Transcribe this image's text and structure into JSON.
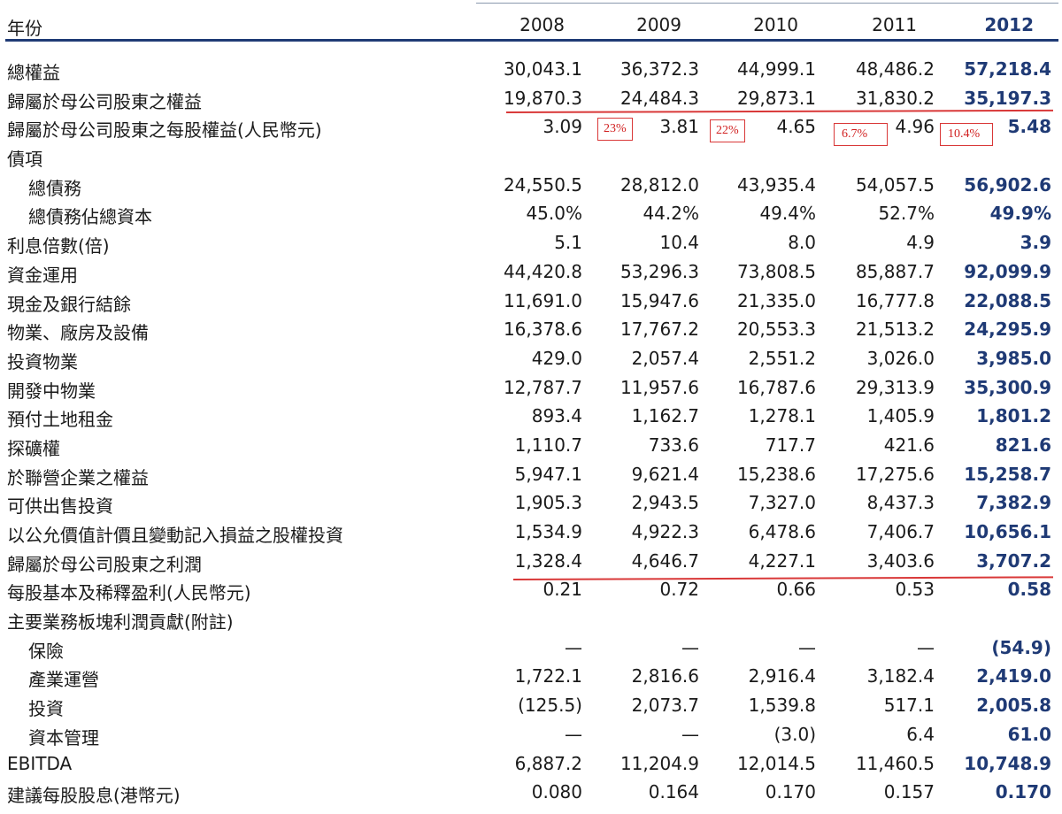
{
  "header": {
    "label": "年份",
    "years": [
      "2008",
      "2009",
      "2010",
      "2011",
      "2012"
    ]
  },
  "rows": [
    {
      "label": "總權益",
      "indent": false,
      "values": [
        "30,043.1",
        "36,372.3",
        "44,999.1",
        "48,486.2",
        "57,218.4"
      ]
    },
    {
      "label": "歸屬於母公司股東之權益",
      "indent": false,
      "values": [
        "19,870.3",
        "24,484.3",
        "29,873.1",
        "31,830.2",
        "35,197.3"
      ]
    },
    {
      "label": "歸屬於母公司股東之每股權益(人民幣元)",
      "indent": false,
      "values": [
        "3.09",
        "3.81",
        "4.65",
        "4.96",
        "5.48"
      ]
    },
    {
      "label": "債項",
      "indent": false,
      "values": [
        "",
        "",
        "",
        "",
        ""
      ]
    },
    {
      "label": "總債務",
      "indent": true,
      "values": [
        "24,550.5",
        "28,812.0",
        "43,935.4",
        "54,057.5",
        "56,902.6"
      ]
    },
    {
      "label": "總債務佔總資本",
      "indent": true,
      "values": [
        "45.0%",
        "44.2%",
        "49.4%",
        "52.7%",
        "49.9%"
      ]
    },
    {
      "label": "利息倍數(倍)",
      "indent": false,
      "values": [
        "5.1",
        "10.4",
        "8.0",
        "4.9",
        "3.9"
      ]
    },
    {
      "label": "資金運用",
      "indent": false,
      "values": [
        "44,420.8",
        "53,296.3",
        "73,808.5",
        "85,887.7",
        "92,099.9"
      ]
    },
    {
      "label": "現金及銀行結餘",
      "indent": false,
      "values": [
        "11,691.0",
        "15,947.6",
        "21,335.0",
        "16,777.8",
        "22,088.5"
      ]
    },
    {
      "label": "物業、廠房及設備",
      "indent": false,
      "values": [
        "16,378.6",
        "17,767.2",
        "20,553.3",
        "21,513.2",
        "24,295.9"
      ]
    },
    {
      "label": "投資物業",
      "indent": false,
      "values": [
        "429.0",
        "2,057.4",
        "2,551.2",
        "3,026.0",
        "3,985.0"
      ]
    },
    {
      "label": "開發中物業",
      "indent": false,
      "values": [
        "12,787.7",
        "11,957.6",
        "16,787.6",
        "29,313.9",
        "35,300.9"
      ]
    },
    {
      "label": "預付土地租金",
      "indent": false,
      "values": [
        "893.4",
        "1,162.7",
        "1,278.1",
        "1,405.9",
        "1,801.2"
      ]
    },
    {
      "label": "探礦權",
      "indent": false,
      "values": [
        "1,110.7",
        "733.6",
        "717.7",
        "421.6",
        "821.6"
      ]
    },
    {
      "label": "於聯營企業之權益",
      "indent": false,
      "values": [
        "5,947.1",
        "9,621.4",
        "15,238.6",
        "17,275.6",
        "15,258.7"
      ]
    },
    {
      "label": "可供出售投資",
      "indent": false,
      "values": [
        "1,905.3",
        "2,943.5",
        "7,327.0",
        "8,437.3",
        "7,382.9"
      ]
    },
    {
      "label": "以公允價值計價且變動記入損益之股權投資",
      "indent": false,
      "values": [
        "1,534.9",
        "4,922.3",
        "6,478.6",
        "7,406.7",
        "10,656.1"
      ]
    },
    {
      "label": "歸屬於母公司股東之利潤",
      "indent": false,
      "values": [
        "1,328.4",
        "4,646.7",
        "4,227.1",
        "3,403.6",
        "3,707.2"
      ]
    },
    {
      "label": "每股基本及稀釋盈利(人民幣元)",
      "indent": false,
      "values": [
        "0.21",
        "0.72",
        "0.66",
        "0.53",
        "0.58"
      ]
    },
    {
      "label": "主要業務板塊利潤貢獻(附註)",
      "indent": false,
      "values": [
        "",
        "",
        "",
        "",
        ""
      ]
    },
    {
      "label": "保險",
      "indent": true,
      "values": [
        "—",
        "—",
        "—",
        "—",
        "(54.9)"
      ]
    },
    {
      "label": "產業運營",
      "indent": true,
      "values": [
        "1,722.1",
        "2,816.6",
        "2,916.4",
        "3,182.4",
        "2,419.0"
      ]
    },
    {
      "label": "投資",
      "indent": true,
      "values": [
        "(125.5)",
        "2,073.7",
        "1,539.8",
        "517.1",
        "2,005.8"
      ]
    },
    {
      "label": "資本管理",
      "indent": true,
      "values": [
        "—",
        "—",
        "(3.0)",
        "6.4",
        "61.0"
      ]
    },
    {
      "label": "EBITDA",
      "indent": false,
      "values": [
        "6,887.2",
        "11,204.9",
        "12,014.5",
        "11,460.5",
        "10,748.9"
      ]
    },
    {
      "label": "建議每股股息(港幣元)",
      "indent": false,
      "values": [
        "0.080",
        "0.164",
        "0.170",
        "0.157",
        "0.170"
      ]
    }
  ],
  "annotations": [
    "23%",
    "22%",
    "6.7%",
    "10.4%"
  ],
  "colors": {
    "accent": "#1f3a75",
    "annotation": "#d93838"
  }
}
